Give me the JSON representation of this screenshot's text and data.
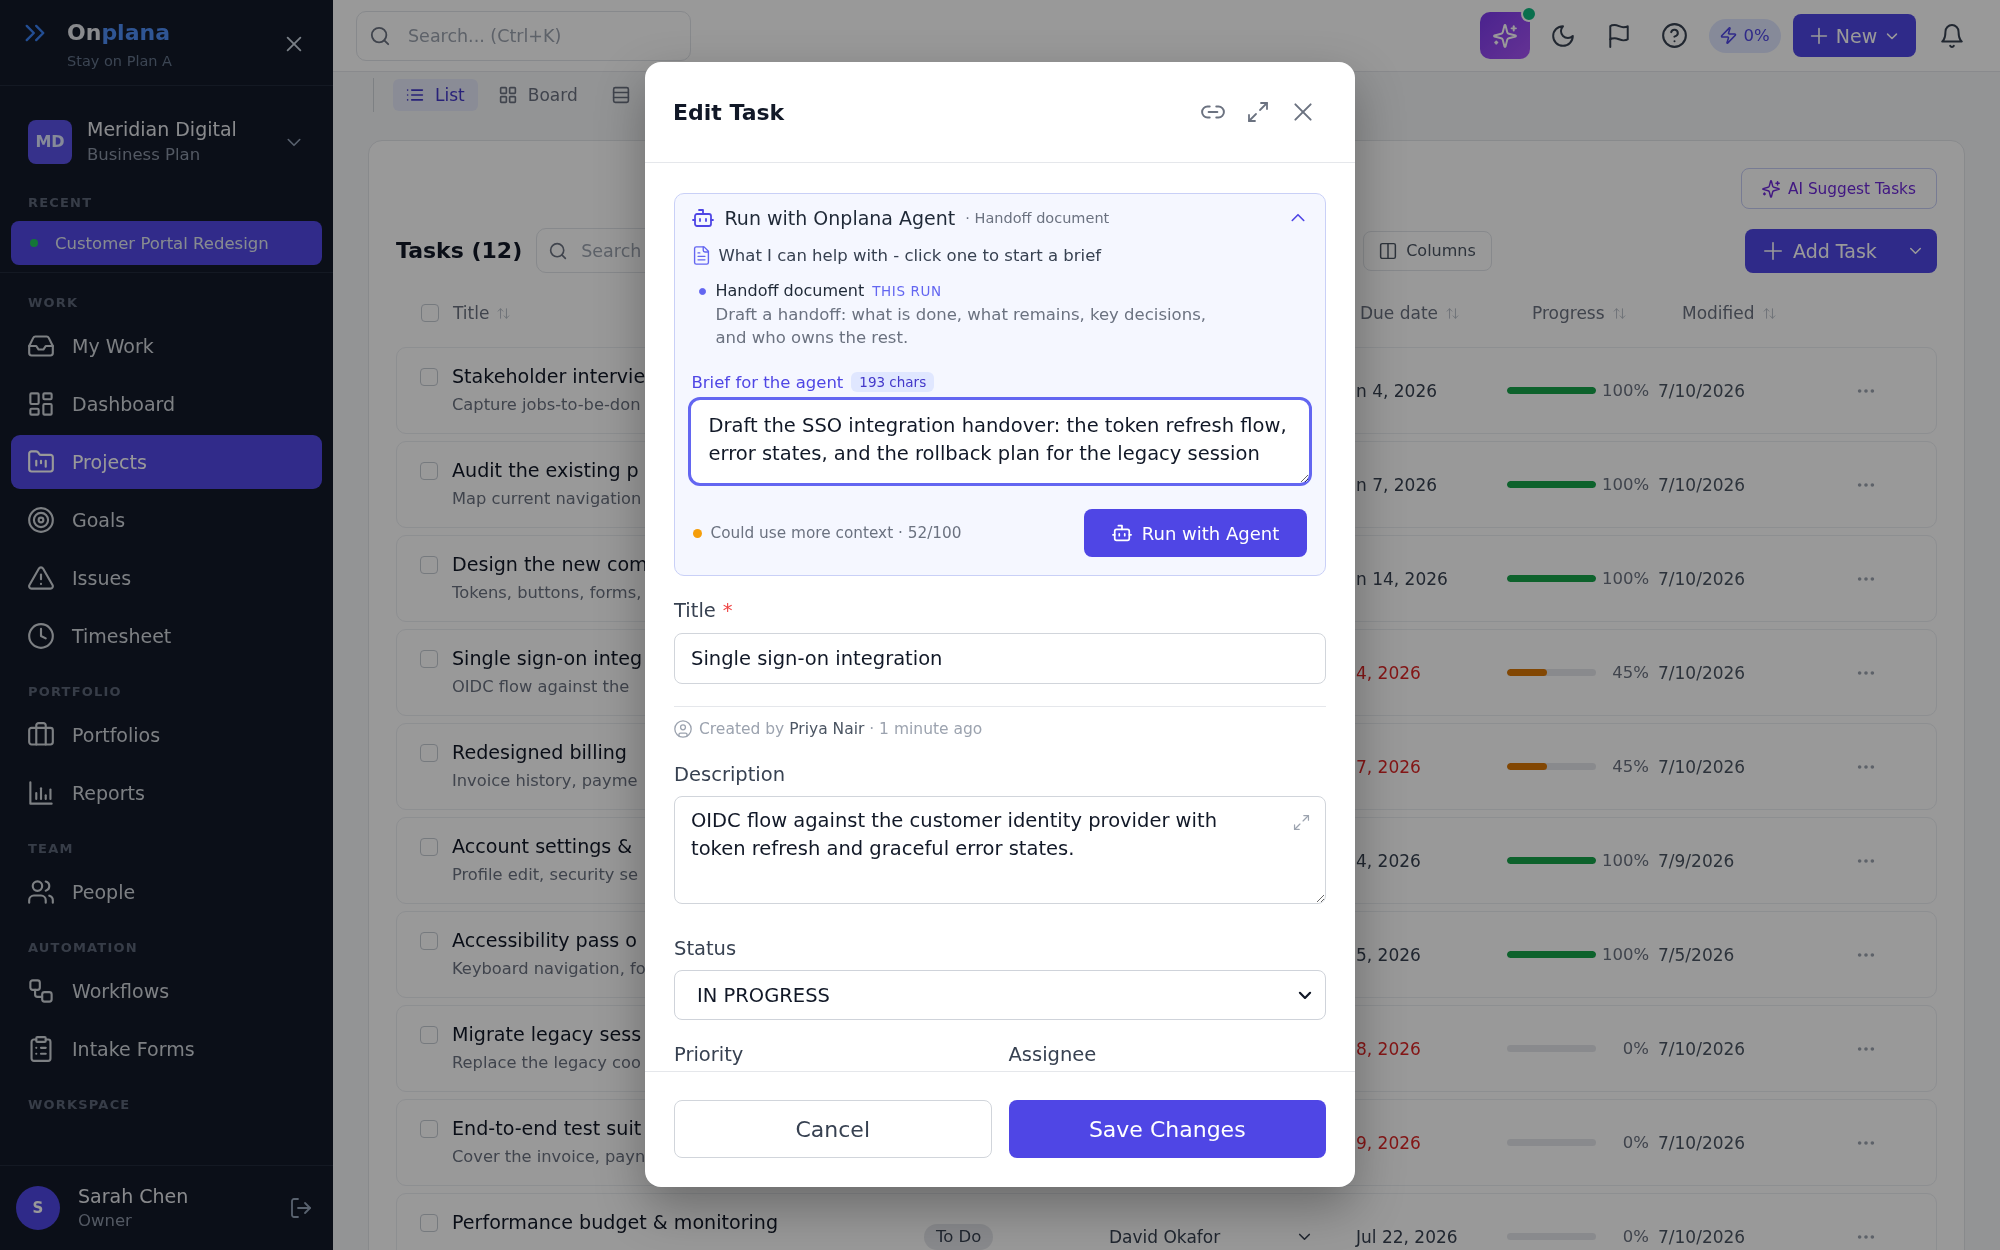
{
  "sidebar": {
    "brand": {
      "name_start": "On",
      "name_end": "plana",
      "tagline": "Stay on Plan A"
    },
    "workspace": {
      "initials": "MD",
      "name": "Meridian Digital",
      "plan": "Business Plan"
    },
    "recent": {
      "heading": "RECENT",
      "items": [
        {
          "label": "Customer Portal Redesign",
          "selected": true
        }
      ]
    },
    "sections": [
      {
        "heading": "WORK",
        "items": [
          {
            "label": "My Work",
            "selected": false
          },
          {
            "label": "Dashboard",
            "selected": false
          },
          {
            "label": "Projects",
            "selected": true
          },
          {
            "label": "Goals",
            "selected": false
          },
          {
            "label": "Issues",
            "selected": false
          },
          {
            "label": "Timesheet",
            "selected": false
          }
        ]
      },
      {
        "heading": "PORTFOLIO",
        "items": [
          {
            "label": "Portfolios",
            "selected": false
          },
          {
            "label": "Reports",
            "selected": false
          }
        ]
      },
      {
        "heading": "TEAM",
        "items": [
          {
            "label": "People",
            "selected": false
          }
        ]
      },
      {
        "heading": "AUTOMATION",
        "items": [
          {
            "label": "Workflows",
            "selected": false
          },
          {
            "label": "Intake Forms",
            "selected": false
          }
        ]
      },
      {
        "heading": "WORKSPACE"
      }
    ],
    "user": {
      "initial": "S",
      "name": "Sarah Chen",
      "role": "Owner"
    }
  },
  "topbar": {
    "search_placeholder": "Search... (Ctrl+K)",
    "assistant_notification": true,
    "usage": "0%",
    "new_button": "New"
  },
  "view_tabs": [
    {
      "label": "List",
      "selected": true
    },
    {
      "label": "Board",
      "selected": false
    },
    {
      "selected": false
    }
  ],
  "tasks": {
    "ai_suggest_button": "AI Suggest Tasks",
    "title": "Tasks (12)",
    "search_placeholder": "Search",
    "columns_button": "Columns",
    "add_button": "Add Task",
    "select_all_checked": false,
    "columns": [
      {
        "label": "Title"
      },
      {
        "label": "Due date"
      },
      {
        "label": "Progress"
      },
      {
        "label": "Modified"
      }
    ],
    "rows": [
      {
        "title": "Stakeholder intervie",
        "description": "Capture jobs-to-be-don",
        "checked": false,
        "due": "n 4, 2026",
        "overdue": false,
        "level": 1,
        "percent": "100%",
        "modified": "7/10/2026"
      },
      {
        "title": "Audit the existing p",
        "description": "Map current navigation",
        "checked": false,
        "due": "n 7, 2026",
        "overdue": false,
        "level": 1,
        "percent": "100%",
        "modified": "7/10/2026"
      },
      {
        "title": "Design the new com",
        "description": "Tokens, buttons, forms,",
        "checked": false,
        "due": "n 14, 2026",
        "overdue": false,
        "level": 1,
        "percent": "100%",
        "modified": "7/10/2026"
      },
      {
        "title": "Single sign-on integ",
        "description": "OIDC flow against the",
        "checked": false,
        "due": "4, 2026",
        "overdue": true,
        "level": 0.45,
        "percent": "45%",
        "modified": "7/10/2026"
      },
      {
        "title": "Redesigned billing",
        "description": "Invoice history, payme",
        "checked": false,
        "due": "7, 2026",
        "overdue": true,
        "level": 0.45,
        "percent": "45%",
        "modified": "7/10/2026"
      },
      {
        "title": "Account settings &",
        "description": "Profile edit, security se",
        "checked": false,
        "due": "4, 2026",
        "overdue": false,
        "level": 1,
        "percent": "100%",
        "modified": "7/9/2026"
      },
      {
        "title": "Accessibility pass o",
        "description": "Keyboard navigation, fo",
        "checked": false,
        "due": "5, 2026",
        "overdue": false,
        "level": 1,
        "percent": "100%",
        "modified": "7/5/2026"
      },
      {
        "title": "Migrate legacy sess",
        "description": "Replace the legacy coo",
        "checked": false,
        "due": "8, 2026",
        "overdue": true,
        "level": 0,
        "percent": "0%",
        "modified": "7/10/2026"
      },
      {
        "title": "End-to-end test suit",
        "description": "Cover the invoice, payn",
        "checked": false,
        "due": "9, 2026",
        "overdue": true,
        "level": 0,
        "percent": "0%",
        "modified": "7/10/2026"
      },
      {
        "title": "Performance budget & monitoring",
        "checked": false,
        "status": "To Do",
        "assignee": "David Okafor",
        "due": "Jul 22, 2026",
        "overdue": false,
        "level": 0,
        "percent": "0%",
        "modified": "7/10/2026"
      }
    ]
  },
  "modal": {
    "title": "Edit Task",
    "agent": {
      "title": "Run with Onplana Agent",
      "context": "· Handoff document",
      "expanded": true,
      "help_text": "What I can help with - click one to start a brief",
      "options": [
        {
          "label": "Handoff document",
          "tag": "THIS RUN",
          "description": "Draft a handoff: what is done, what remains, key decisions, and who owns the rest.",
          "selected": true
        }
      ],
      "brief_label": "Brief for the agent",
      "char_count": "193 chars",
      "brief": "Draft the SSO integration handover: the token refresh flow, error states, and the rollback plan for the legacy session",
      "quality": {
        "text": "Could use more context · 52/100",
        "warning": true
      },
      "run_button": "Run with Agent"
    },
    "title_field": {
      "label": "Title",
      "required_mark": "*",
      "value": "Single sign-on integration"
    },
    "created": {
      "prefix": "Created by",
      "author": "Priya Nair",
      "time": "· 1 minute ago"
    },
    "description_field": {
      "label": "Description",
      "value": "OIDC flow against the customer identity provider with token refresh and graceful error states."
    },
    "status_field": {
      "label": "Status",
      "value": "IN PROGRESS"
    },
    "priority_label": "Priority",
    "assignee_label": "Assignee",
    "cancel_button": "Cancel",
    "save_button": "Save Changes"
  }
}
